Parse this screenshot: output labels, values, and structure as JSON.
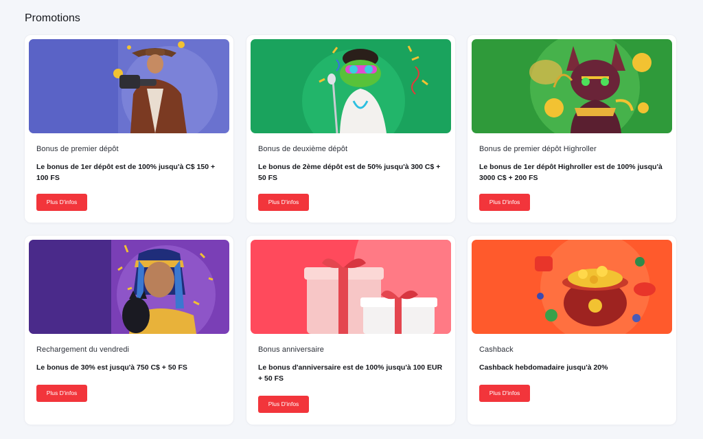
{
  "page": {
    "title": "Promotions"
  },
  "promotions": [
    {
      "title": "Bonus de premier dépôt",
      "description": "Le bonus de 1er dépôt est de 100% jusqu'à C$ 150 + 100 FS",
      "button_label": "Plus D'infos",
      "banner_color": "#6a72cf"
    },
    {
      "title": "Bonus de deuxième dépôt",
      "description": "Le bonus de 2ème dépôt est de 50% jusqu'à 300 C$ + 50 FS",
      "button_label": "Plus D'infos",
      "banner_color": "#1aa35d"
    },
    {
      "title": "Bonus de premier dépôt Highroller",
      "description": "Le bonus de 1er dépôt Highroller est de 100% jusqu'à 3000 C$ + 200 FS",
      "button_label": "Plus D'infos",
      "banner_color": "#3ba83f"
    },
    {
      "title": "Rechargement du vendredi",
      "description": "Le bonus de 30% est jusqu'à 750 C$ + 50 FS",
      "button_label": "Plus D'infos",
      "banner_color": "#7a3fb6"
    },
    {
      "title": "Bonus anniversaire",
      "description": "Le bonus d'anniversaire est de 100% jusqu'à 100 EUR + 50 FS",
      "button_label": "Plus D'infos",
      "banner_color": "#ff5060"
    },
    {
      "title": "Cashback",
      "description": "Cashback hebdomadaire jusqu'à 20%",
      "button_label": "Plus D'infos",
      "banner_color": "#ff5a2c"
    }
  ],
  "colors": {
    "button": "#f2353b",
    "page_background": "#f4f6fa",
    "card_background": "#ffffff"
  }
}
